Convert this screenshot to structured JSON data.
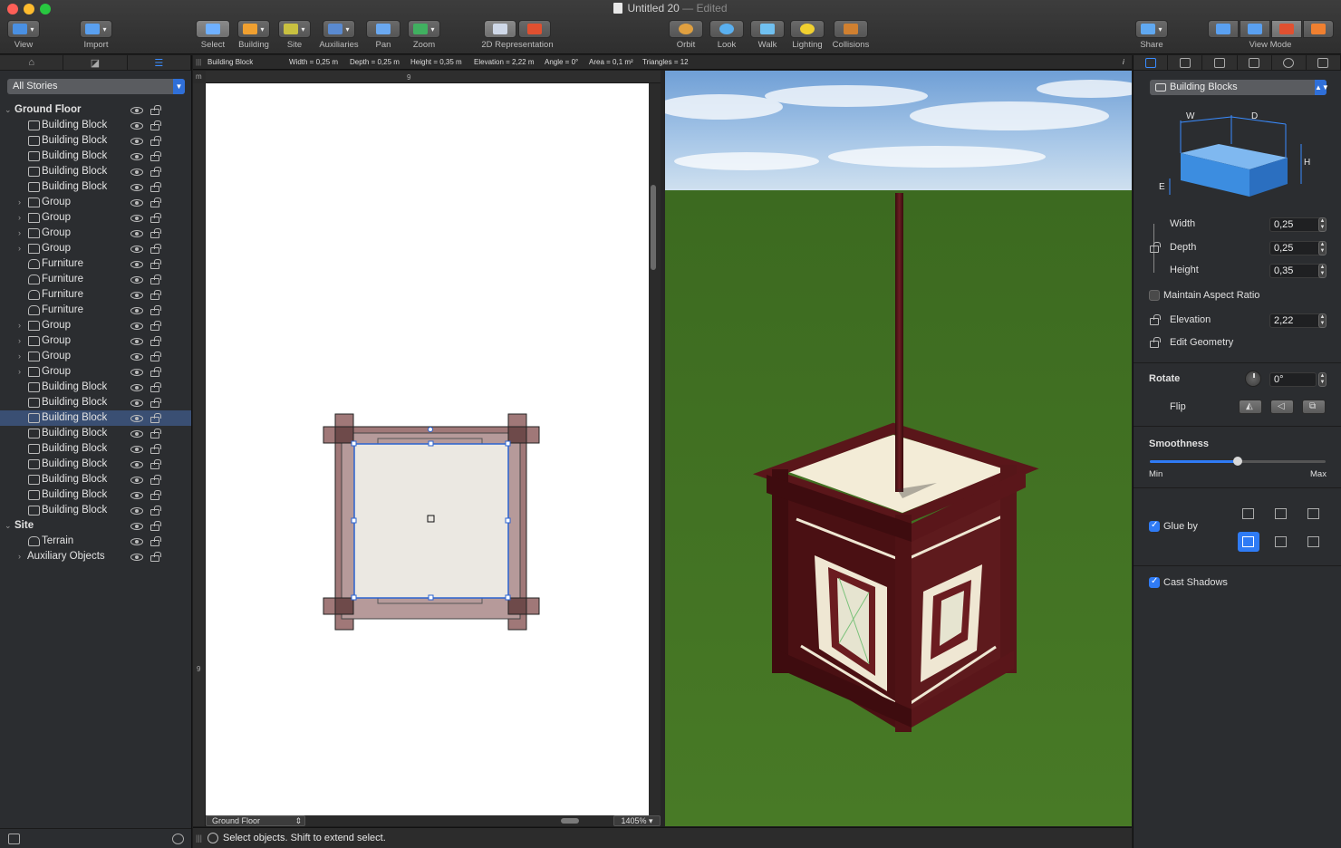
{
  "window": {
    "title": "Untitled 20",
    "edited_suffix": "— Edited"
  },
  "toolbar": {
    "view": "View",
    "import": "Import",
    "select": "Select",
    "building": "Building",
    "site": "Site",
    "auxiliaries": "Auxiliaries",
    "pan": "Pan",
    "zoom": "Zoom",
    "representation_2d": "2D Representation",
    "orbit": "Orbit",
    "look": "Look",
    "walk": "Walk",
    "lighting": "Lighting",
    "collisions": "Collisions",
    "share": "Share",
    "view_mode": "View Mode"
  },
  "sidebar": {
    "stories_selector": "All Stories",
    "tree": [
      {
        "label": "Ground Floor",
        "level": 0,
        "type": "story",
        "expanded": true
      },
      {
        "label": "Building Block",
        "level": 1,
        "type": "block"
      },
      {
        "label": "Building Block",
        "level": 1,
        "type": "block"
      },
      {
        "label": "Building Block",
        "level": 1,
        "type": "block"
      },
      {
        "label": "Building Block",
        "level": 1,
        "type": "block"
      },
      {
        "label": "Building Block",
        "level": 1,
        "type": "block"
      },
      {
        "label": "Group",
        "level": 1,
        "type": "group"
      },
      {
        "label": "Group",
        "level": 1,
        "type": "group"
      },
      {
        "label": "Group",
        "level": 1,
        "type": "group"
      },
      {
        "label": "Group",
        "level": 1,
        "type": "group"
      },
      {
        "label": "Furniture",
        "level": 1,
        "type": "furniture"
      },
      {
        "label": "Furniture",
        "level": 1,
        "type": "furniture"
      },
      {
        "label": "Furniture",
        "level": 1,
        "type": "furniture"
      },
      {
        "label": "Furniture",
        "level": 1,
        "type": "furniture"
      },
      {
        "label": "Group",
        "level": 1,
        "type": "group"
      },
      {
        "label": "Group",
        "level": 1,
        "type": "group"
      },
      {
        "label": "Group",
        "level": 1,
        "type": "group"
      },
      {
        "label": "Group",
        "level": 1,
        "type": "group"
      },
      {
        "label": "Building Block",
        "level": 1,
        "type": "block"
      },
      {
        "label": "Building Block",
        "level": 1,
        "type": "block"
      },
      {
        "label": "Building Block",
        "level": 1,
        "type": "block",
        "selected": true
      },
      {
        "label": "Building Block",
        "level": 1,
        "type": "block"
      },
      {
        "label": "Building Block",
        "level": 1,
        "type": "block"
      },
      {
        "label": "Building Block",
        "level": 1,
        "type": "block"
      },
      {
        "label": "Building Block",
        "level": 1,
        "type": "block"
      },
      {
        "label": "Building Block",
        "level": 1,
        "type": "block"
      },
      {
        "label": "Building Block",
        "level": 1,
        "type": "block"
      },
      {
        "label": "Site",
        "level": 0,
        "type": "story",
        "expanded": true
      },
      {
        "label": "Terrain",
        "level": 1,
        "type": "terrain"
      },
      {
        "label": "Auxiliary Objects",
        "level": 1,
        "type": "aux"
      }
    ]
  },
  "info_bar": {
    "object": "Building Block",
    "width": "Width = 0,25 m",
    "depth": "Depth = 0,25 m",
    "height": "Height = 0,35 m",
    "elevation": "Elevation = 2,22 m",
    "angle": "Angle = 0°",
    "area": "Area = 0,1 m²",
    "triangles": "Triangles = 12"
  },
  "plan": {
    "ruler_unit": "m",
    "ruler_top_tick": "9",
    "ruler_left_tick": "9",
    "story": "Ground Floor",
    "zoom": "1405%"
  },
  "status": {
    "message": "Select objects. Shift to extend select."
  },
  "inspector": {
    "category": "Building Blocks",
    "diagram_labels": {
      "w": "W",
      "d": "D",
      "h": "H",
      "e": "E"
    },
    "width_label": "Width",
    "width_value": "0,25",
    "depth_label": "Depth",
    "depth_value": "0,25",
    "height_label": "Height",
    "height_value": "0,35",
    "maintain_aspect_label": "Maintain Aspect Ratio",
    "maintain_aspect": false,
    "elevation_label": "Elevation",
    "elevation_value": "2,22",
    "edit_geometry_label": "Edit Geometry",
    "rotate_label": "Rotate",
    "rotate_value": "0°",
    "flip_label": "Flip",
    "smoothness_label": "Smoothness",
    "smoothness_min": "Min",
    "smoothness_max": "Max",
    "smoothness_value": 0.5,
    "glue_by_label": "Glue by",
    "glue_by": true,
    "cast_shadows_label": "Cast Shadows",
    "cast_shadows": true
  },
  "colors": {
    "accent": "#2f7bf5",
    "selection": "#3a4f73",
    "wood": "#5a1a1c",
    "grass": "#3f6a22",
    "sky": "#9fc3e8"
  }
}
